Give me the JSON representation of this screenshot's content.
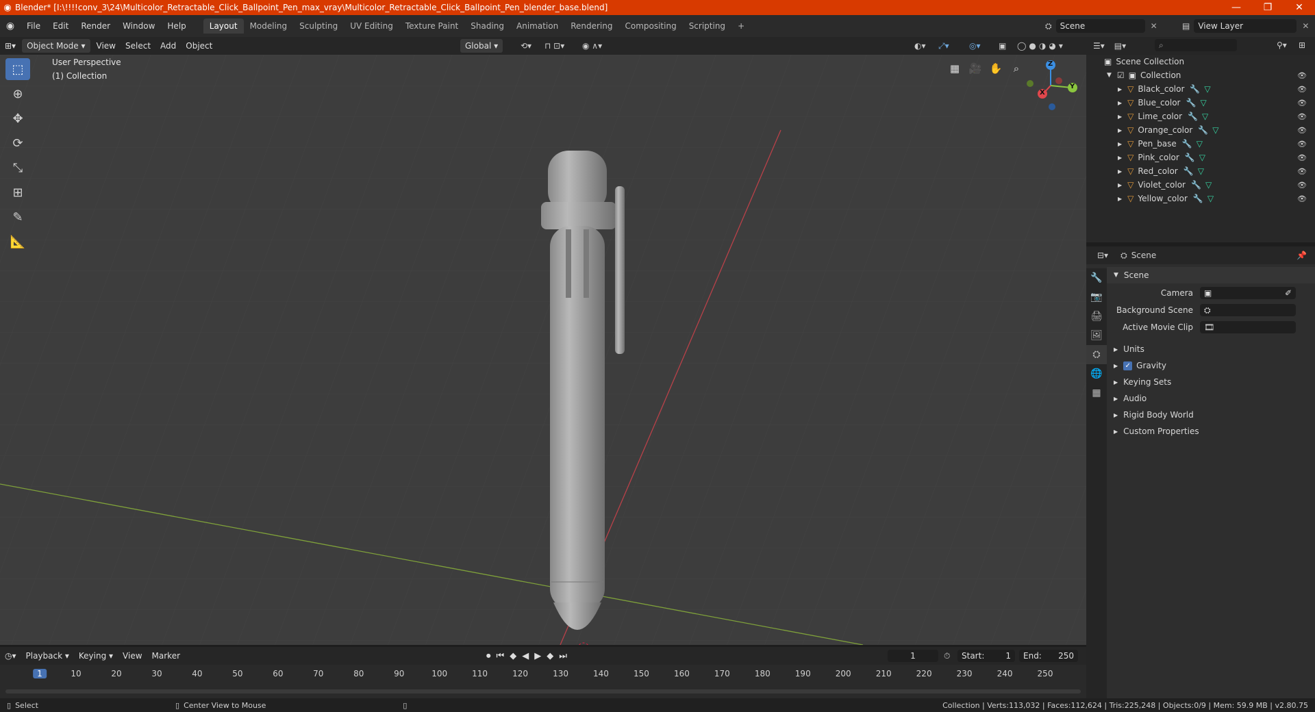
{
  "titlebar": {
    "title": "Blender* [I:\\!!!!conv_3\\24\\Multicolor_Retractable_Click_Ballpoint_Pen_max_vray\\Multicolor_Retractable_Click_Ballpoint_Pen_blender_base.blend]",
    "minimize": "—",
    "restore": "❐",
    "close": "✕"
  },
  "menus": [
    "File",
    "Edit",
    "Render",
    "Window",
    "Help"
  ],
  "workspaces": [
    "Layout",
    "Modeling",
    "Sculpting",
    "UV Editing",
    "Texture Paint",
    "Shading",
    "Animation",
    "Rendering",
    "Compositing",
    "Scripting"
  ],
  "add_workspace": "+",
  "scene_field": "Scene",
  "view_layer_field": "View Layer",
  "viewport_header": {
    "mode": "Object Mode",
    "view": "View",
    "select": "Select",
    "add": "Add",
    "object": "Object",
    "transform": "Global"
  },
  "overlay_text": {
    "perspective": "User Perspective",
    "collection": "(1) Collection"
  },
  "gizmo": {
    "x": "X",
    "y": "Y",
    "z": "Z"
  },
  "outliner": {
    "root": "Scene Collection",
    "collection": "Collection",
    "objects": [
      "Black_color",
      "Blue_color",
      "Lime_color",
      "Orange_color",
      "Pen_base",
      "Pink_color",
      "Red_color",
      "Violet_color",
      "Yellow_color"
    ]
  },
  "properties": {
    "header": "Scene",
    "panel": "Scene",
    "camera_label": "Camera",
    "background_scene_label": "Background Scene",
    "active_movie_clip_label": "Active Movie Clip",
    "sections": [
      "Units",
      "Gravity",
      "Keying Sets",
      "Audio",
      "Rigid Body World",
      "Custom Properties"
    ]
  },
  "timeline": {
    "playback": "Playback",
    "keying": "Keying",
    "view": "View",
    "marker": "Marker",
    "current_frame": "1",
    "start_label": "Start:",
    "start": "1",
    "end_label": "End:",
    "end": "250",
    "ticks": [
      "1",
      "10",
      "20",
      "30",
      "40",
      "50",
      "60",
      "70",
      "80",
      "90",
      "100",
      "110",
      "120",
      "130",
      "140",
      "150",
      "160",
      "170",
      "180",
      "190",
      "200",
      "210",
      "220",
      "230",
      "240",
      "250"
    ]
  },
  "statusbar": {
    "left": "Select",
    "middle": "Center View to Mouse",
    "right": "Collection | Verts:113,032 | Faces:112,624 | Tris:225,248 | Objects:0/9 | Mem: 59.9 MB | v2.80.75"
  },
  "colors": {
    "title_bar": "#d83a00",
    "accent": "#4772b3",
    "axis_x": "#e0474c",
    "axis_y": "#8bc63f",
    "axis_z": "#3b8fe3",
    "viewport_bg": "#3d3d3d"
  }
}
